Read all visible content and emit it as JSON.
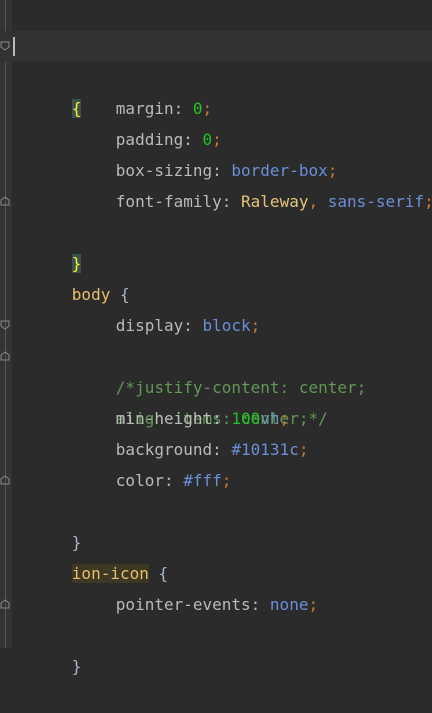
{
  "editor": {
    "lines": [
      {
        "selector": "*"
      },
      {
        "brace": "{"
      },
      {
        "prop": "margin",
        "value": "0"
      },
      {
        "prop": "padding",
        "value": "0"
      },
      {
        "prop": "box-sizing",
        "value": "border-box"
      },
      {
        "prop": "font-family",
        "value1": "Raleway",
        "sep": ", ",
        "value2": "sans-serif"
      },
      {
        "brace": "}"
      },
      {
        "blank": ""
      },
      {
        "selector": "body",
        "brace": "{"
      },
      {
        "prop": "display",
        "value": "block"
      },
      {
        "comment": "/*justify-content: center;"
      },
      {
        "comment": "align-items: center;*/"
      },
      {
        "prop": "min-height",
        "num": "100",
        "unit": "vh"
      },
      {
        "prop": "background",
        "value": "#10131c"
      },
      {
        "prop": "color",
        "value": "#fff"
      },
      {
        "brace": "}"
      },
      {
        "blank": ""
      },
      {
        "selector": "ion-icon",
        "brace": "{"
      },
      {
        "prop": "pointer-events",
        "value": "none"
      },
      {
        "brace": "}"
      }
    ],
    "syntax": {
      ":": ": ",
      ";": ";"
    }
  },
  "colors": {
    "background": "#2b2b2b",
    "selector": "#e8bf6a",
    "number": "#22c325",
    "keyword": "#6a8fd8",
    "comment": "#629755"
  }
}
